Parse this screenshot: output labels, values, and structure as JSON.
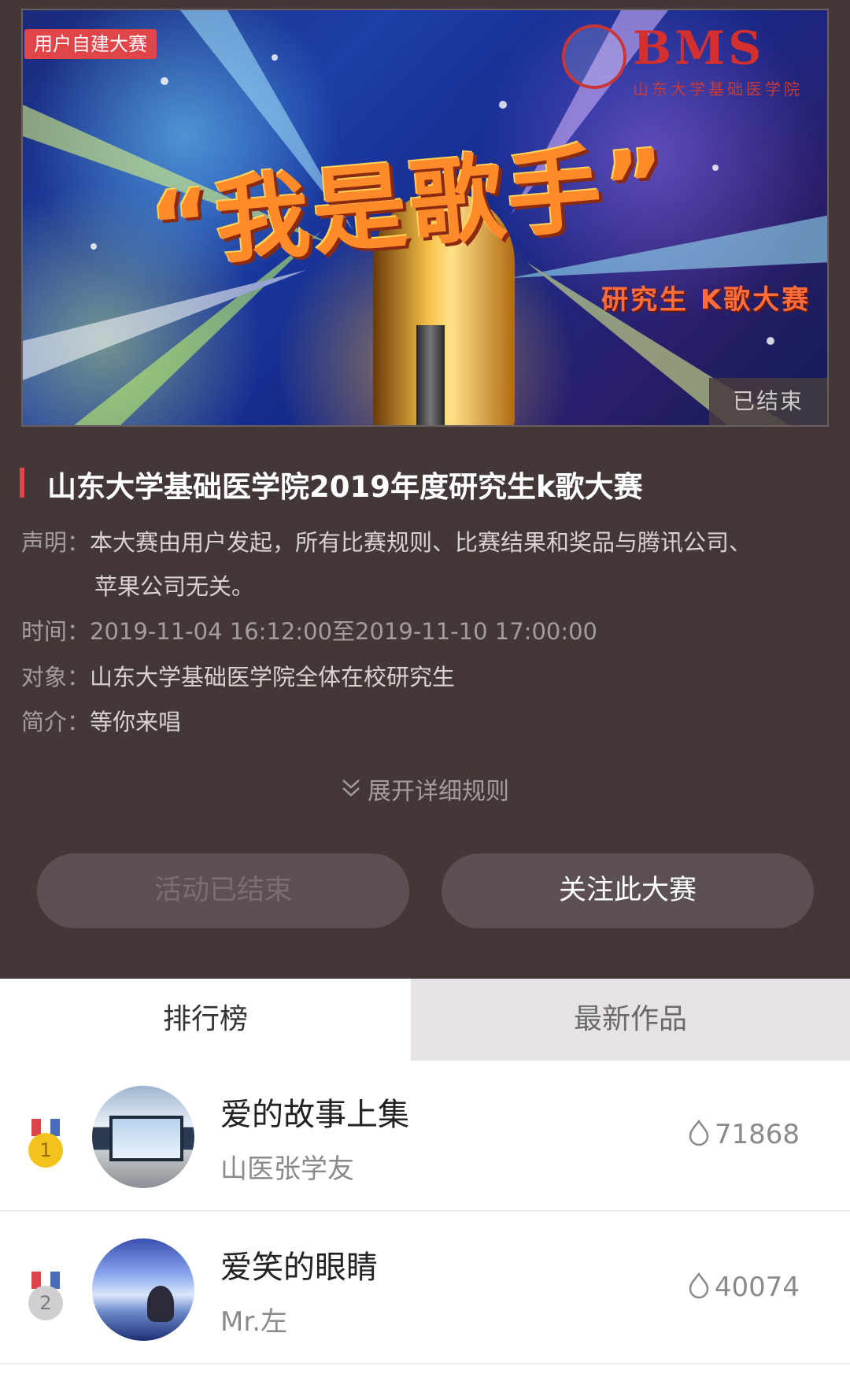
{
  "banner": {
    "badge": "用户自建大赛",
    "logo_text": "BMS",
    "logo_subtitle": "山东大学基础医学院",
    "headline": "“我是歌手”",
    "subline": "研究生 K歌大赛",
    "status": "已结束"
  },
  "contest": {
    "title": "山东大学基础医学院2019年度研究生k歌大赛",
    "statement_label": "声明：",
    "statement_line1": "本大赛由用户发起，所有比赛规则、比赛结果和奖品与腾讯公司、",
    "statement_line2": "苹果公司无关。",
    "time_label": "时间：",
    "time_value": "2019-11-04 16:12:00至2019-11-10 17:00:00",
    "target_label": "对象：",
    "target_value": "山东大学基础医学院全体在校研究生",
    "intro_label": "简介：",
    "intro_value": "等你来唱",
    "expand_label": "展开详细规则"
  },
  "buttons": {
    "ended": "活动已结束",
    "follow": "关注此大赛"
  },
  "tabs": {
    "ranking": "排行榜",
    "latest": "最新作品"
  },
  "ranking": [
    {
      "rank": "1",
      "song": "爱的故事上集",
      "singer": "山医张学友",
      "score": "71868"
    },
    {
      "rank": "2",
      "song": "爱笑的眼睛",
      "singer": "Mr.左",
      "score": "40074"
    }
  ],
  "colors": {
    "background": "#433738",
    "accent": "#e0454a",
    "button": "#5c5052"
  }
}
